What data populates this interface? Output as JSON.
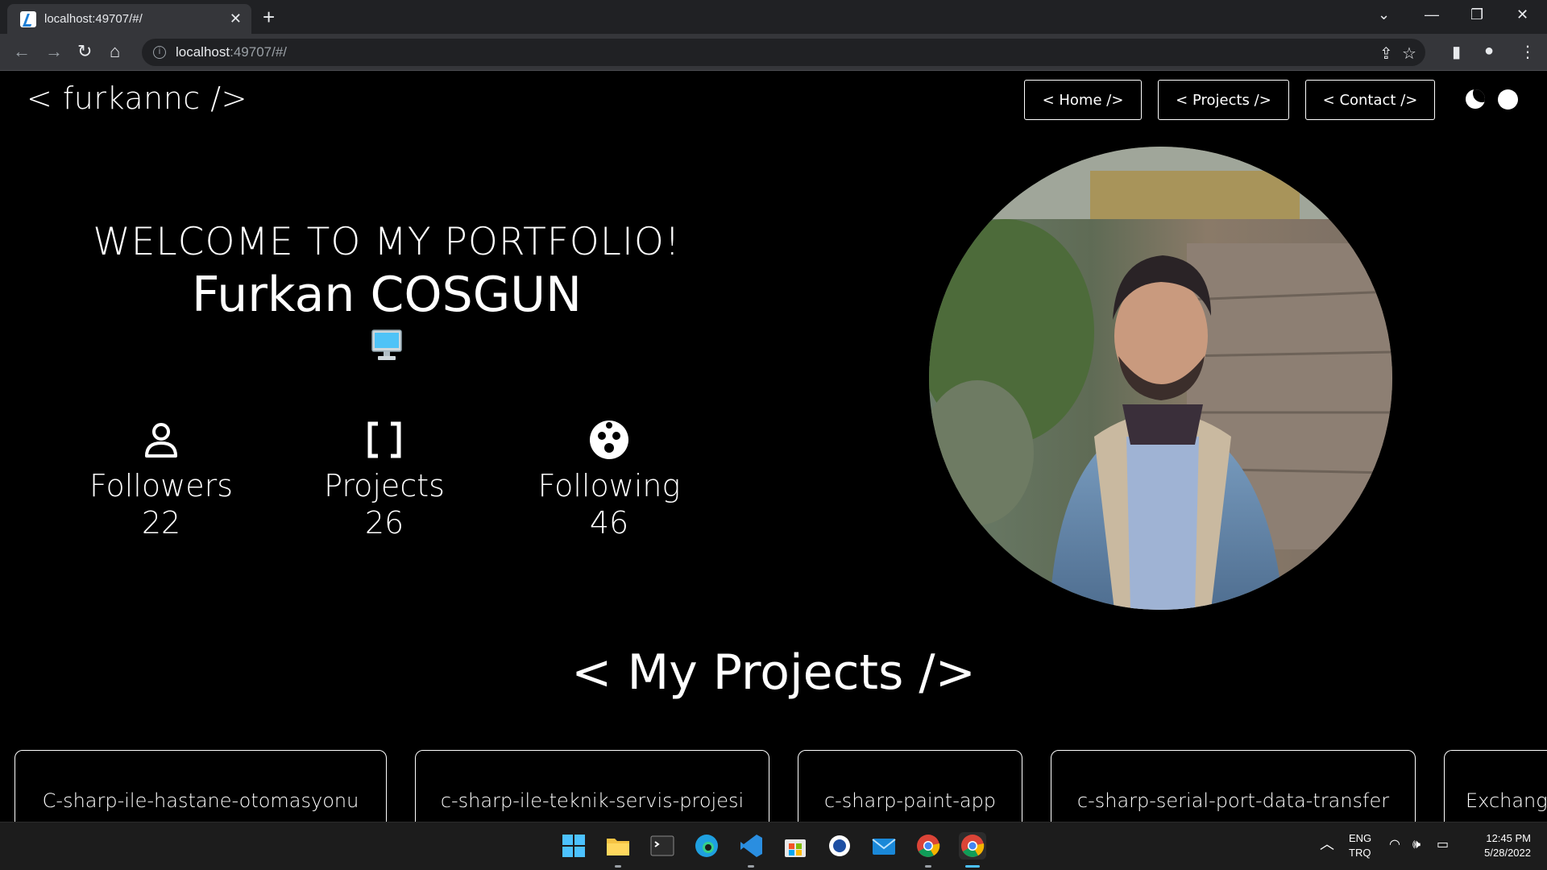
{
  "browser": {
    "tab_title": "localhost:49707/#/",
    "url_host": "localhost",
    "url_rest": ":49707/#/"
  },
  "page": {
    "logo": "< furkannc />",
    "nav": [
      {
        "label": "< Home />"
      },
      {
        "label": "< Projects />"
      },
      {
        "label": "< Contact />"
      }
    ],
    "welcome": "WELCOME TO MY PORTFOLIO!",
    "name": "Furkan COSGUN",
    "stats": [
      {
        "label": "Followers",
        "value": "22",
        "icon": "person-icon"
      },
      {
        "label": "Projects",
        "value": "26",
        "icon": "brackets-icon"
      },
      {
        "label": "Following",
        "value": "46",
        "icon": "face-icon"
      }
    ],
    "projects_title": "< My Projects />",
    "projects": [
      {
        "name": "C-sharp-ile-hastane-otomasyonu"
      },
      {
        "name": "c-sharp-ile-teknik-servis-projesi"
      },
      {
        "name": "c-sharp-paint-app"
      },
      {
        "name": "c-sharp-serial-port-data-transfer"
      },
      {
        "name": "Exchang"
      }
    ]
  },
  "taskbar": {
    "lang_top": "ENG",
    "lang_bottom": "TRQ",
    "time": "12:45 PM",
    "date": "5/28/2022"
  },
  "colors": {
    "background": "#000000",
    "foreground": "#ffffff",
    "browser_dark": "#202124",
    "browser_mid": "#35363a"
  }
}
